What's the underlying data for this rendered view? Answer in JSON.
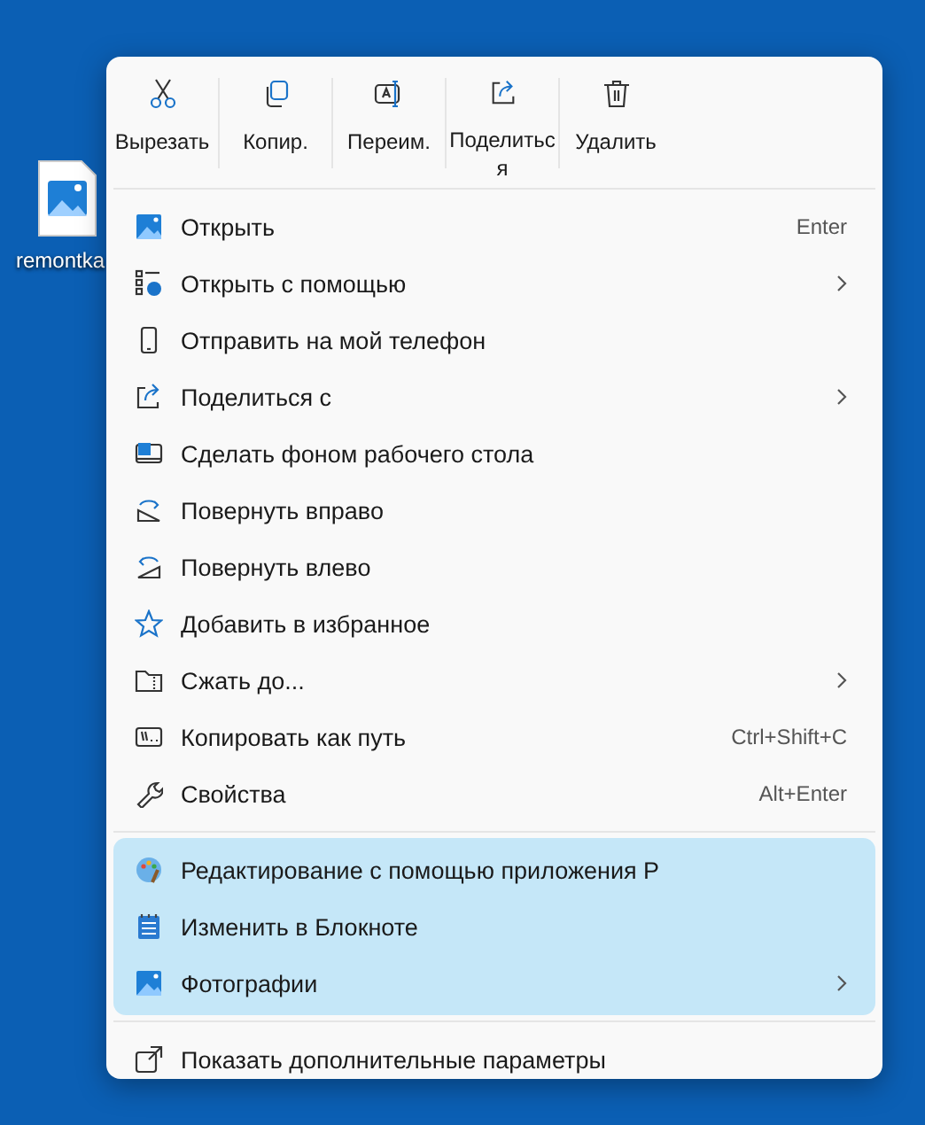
{
  "desktop": {
    "file_label": "remontka"
  },
  "toolbar": [
    {
      "label": "Вырезать"
    },
    {
      "label": "Копир."
    },
    {
      "label": "Переим."
    },
    {
      "label": "Поделиться"
    },
    {
      "label": "Удалить"
    }
  ],
  "sections": [
    {
      "highlighted": false,
      "items": [
        {
          "label": "Открыть",
          "shortcut": "Enter",
          "submenu": false
        },
        {
          "label": "Открыть с помощью",
          "submenu": true
        },
        {
          "label": "Отправить на мой телефон",
          "submenu": false
        },
        {
          "label": "Поделиться с",
          "submenu": true
        },
        {
          "label": "Сделать фоном рабочего стола",
          "submenu": false
        },
        {
          "label": "Повернуть вправо",
          "submenu": false
        },
        {
          "label": "Повернуть влево",
          "submenu": false
        },
        {
          "label": "Добавить в избранное",
          "submenu": false
        },
        {
          "label": "Сжать до...",
          "submenu": true
        },
        {
          "label": "Копировать как путь",
          "shortcut": "Ctrl+Shift+C",
          "submenu": false
        },
        {
          "label": "Свойства",
          "shortcut": "Alt+Enter",
          "submenu": false
        }
      ]
    },
    {
      "highlighted": true,
      "items": [
        {
          "label": "Редактирование с помощью приложения Р",
          "submenu": false
        },
        {
          "label": "Изменить в Блокноте",
          "submenu": false
        },
        {
          "label": "Фотографии",
          "submenu": true
        }
      ]
    },
    {
      "highlighted": false,
      "items": [
        {
          "label": "Показать дополнительные параметры",
          "submenu": false
        }
      ]
    }
  ]
}
